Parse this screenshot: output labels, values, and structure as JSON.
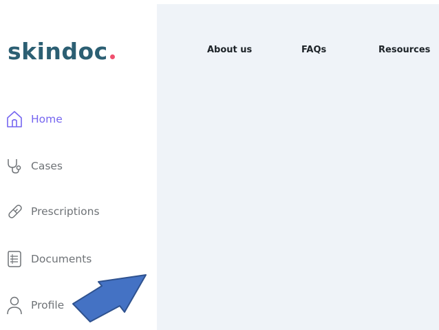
{
  "brand": {
    "name": "skindoc",
    "dot_color": "#f0506e",
    "text_color": "#2c5f73"
  },
  "sidebar": {
    "active_color": "#7565f0",
    "items": [
      {
        "label": "Home",
        "icon": "home-icon",
        "active": true
      },
      {
        "label": "Cases",
        "icon": "stethoscope-icon",
        "active": false
      },
      {
        "label": "Prescriptions",
        "icon": "pill-icon",
        "active": false
      },
      {
        "label": "Documents",
        "icon": "document-icon",
        "active": false
      },
      {
        "label": "Profile",
        "icon": "user-icon",
        "active": false
      }
    ]
  },
  "top_nav": {
    "links": [
      "About us",
      "FAQs",
      "Resources"
    ]
  },
  "annotation": {
    "type": "arrow",
    "color": "#4472c4",
    "points_to": "Profile"
  }
}
